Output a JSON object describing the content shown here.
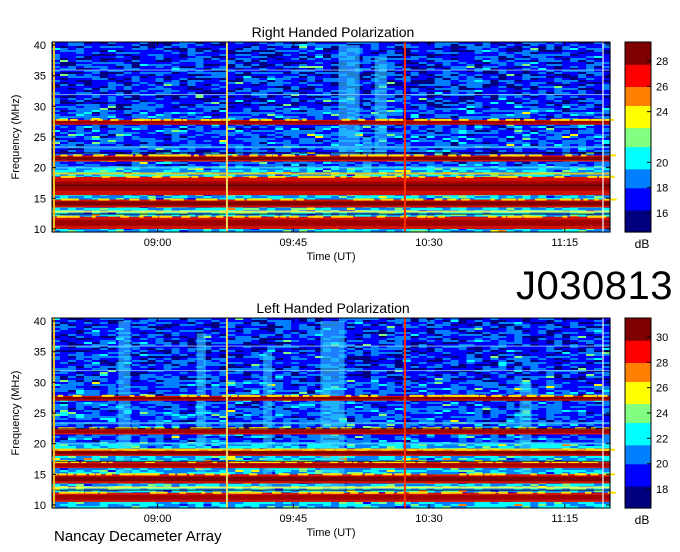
{
  "page": {
    "title": "J030813",
    "footer": "Nancay Decameter Array"
  },
  "colors": {
    "colormap": [
      "#00007f",
      "#0000ff",
      "#0080ff",
      "#00ffff",
      "#80ff80",
      "#ffff00",
      "#ff8000",
      "#ff0000",
      "#7f0000"
    ]
  },
  "chart_data": [
    {
      "type": "heatmap",
      "title": "Right Handed Polarization",
      "xlabel": "Time (UT)",
      "ylabel": "Frequency (MHz)",
      "x_ticks": [
        "09:00",
        "09:45",
        "10:30",
        "11:15"
      ],
      "x_tick_minutes": [
        540,
        585,
        630,
        675
      ],
      "x_range_minutes": [
        505,
        690
      ],
      "y_ticks": [
        10,
        15,
        20,
        25,
        30,
        35,
        40
      ],
      "ylim": [
        9.5,
        40.5
      ],
      "colorbar_label": "dB",
      "colorbar_ticks": [
        16,
        18,
        20,
        24,
        26,
        28
      ],
      "colorbar_range": [
        14.5,
        29.5
      ],
      "strong_bands_mhz": [
        [
          10,
          12
        ],
        [
          13.5,
          14.8
        ],
        [
          15.5,
          18.5
        ],
        [
          21,
          22
        ],
        [
          27,
          27.8
        ]
      ],
      "vertical_markers_minutes": [
        563,
        622
      ]
    },
    {
      "type": "heatmap",
      "title": "Left Handed Polarization",
      "xlabel": "Time (UT)",
      "ylabel": "Frequency (MHz)",
      "x_ticks": [
        "09:00",
        "09:45",
        "10:30",
        "11:15"
      ],
      "x_tick_minutes": [
        540,
        585,
        630,
        675
      ],
      "x_range_minutes": [
        505,
        690
      ],
      "y_ticks": [
        10,
        15,
        20,
        25,
        30,
        35,
        40
      ],
      "ylim": [
        9.5,
        40.5
      ],
      "colorbar_label": "dB",
      "colorbar_ticks": [
        18,
        20,
        22,
        24,
        26,
        28,
        30
      ],
      "colorbar_range": [
        16.5,
        31.5
      ],
      "strong_bands_mhz": [
        [
          10.5,
          12
        ],
        [
          13.5,
          15
        ],
        [
          16,
          17
        ],
        [
          18,
          19
        ],
        [
          21.5,
          22.5
        ],
        [
          27,
          27.8
        ]
      ],
      "vertical_markers_minutes": [
        563,
        622
      ]
    }
  ]
}
